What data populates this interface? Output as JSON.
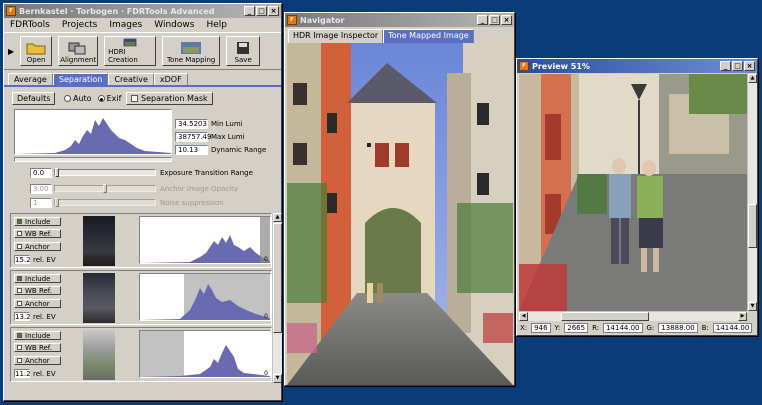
{
  "main_window": {
    "title": "Bernkastel · Torbogen · FDRTools Advanced",
    "menu": [
      "FDRTools",
      "Projects",
      "Images",
      "Windows",
      "Help"
    ],
    "toolbar": [
      {
        "label": "Open",
        "icon": "folder-icon"
      },
      {
        "label": "Alignment",
        "icon": "alignment-icon"
      },
      {
        "label": "HDRI Creation",
        "icon": "hdri-creation-icon"
      },
      {
        "label": "Tone Mapping",
        "icon": "tone-mapping-icon"
      },
      {
        "label": "Save",
        "icon": "floppy-disk-icon"
      }
    ],
    "tabs": [
      "Average",
      "Separation",
      "Creative",
      "xDOF"
    ],
    "selected_tab": "Separation",
    "defaults_label": "Defaults",
    "radio_auto": "Auto",
    "radio_exif": "Exif",
    "separation_mask_label": "Separation Mask",
    "min_lumi_value": "34.5203",
    "min_lumi_label": "Min Lumi",
    "max_lumi_value": "38757.49",
    "max_lumi_label": "Max Lumi",
    "dynamic_range_value": "10.13",
    "dynamic_range_label": "Dynamic Range",
    "exposure_value": "0.0",
    "exposure_label": "Exposure Transition Range",
    "anchor_value": "3.00",
    "anchor_label": "Anchor Image Opacity",
    "noise_value": "1",
    "noise_label": "Noise suppression",
    "image_rows": [
      {
        "include": "Include",
        "wb": "WB Ref.",
        "anchor": "Anchor",
        "ev": "15.2",
        "ev_label": "rel. EV",
        "hist_value": "0"
      },
      {
        "include": "Include",
        "wb": "WB Ref.",
        "anchor": "Anchor",
        "ev": "13.2",
        "ev_label": "rel. EV",
        "hist_value": "0"
      },
      {
        "include": "Include",
        "wb": "WB Ref.",
        "anchor": "Anchor",
        "ev": "11.2",
        "ev_label": "rel. EV",
        "hist_value": "0"
      }
    ]
  },
  "navigator": {
    "title": "Navigator",
    "tabs": [
      "HDR Image Inspector",
      "Tone Mapped Image"
    ],
    "selected_tab": "Tone Mapped Image"
  },
  "preview": {
    "title": "Preview 51%",
    "status": {
      "x_label": "X:",
      "x": "946",
      "y_label": "Y:",
      "y": "2665",
      "r_label": "R:",
      "r": "14144.00",
      "g_label": "G:",
      "g": "13888.00",
      "b_label": "B:",
      "b": "14144.00"
    }
  },
  "colors": {
    "accent": "#5a6fc4",
    "desktop": "#0b3c7a",
    "histogram": "#6a6ab0"
  }
}
